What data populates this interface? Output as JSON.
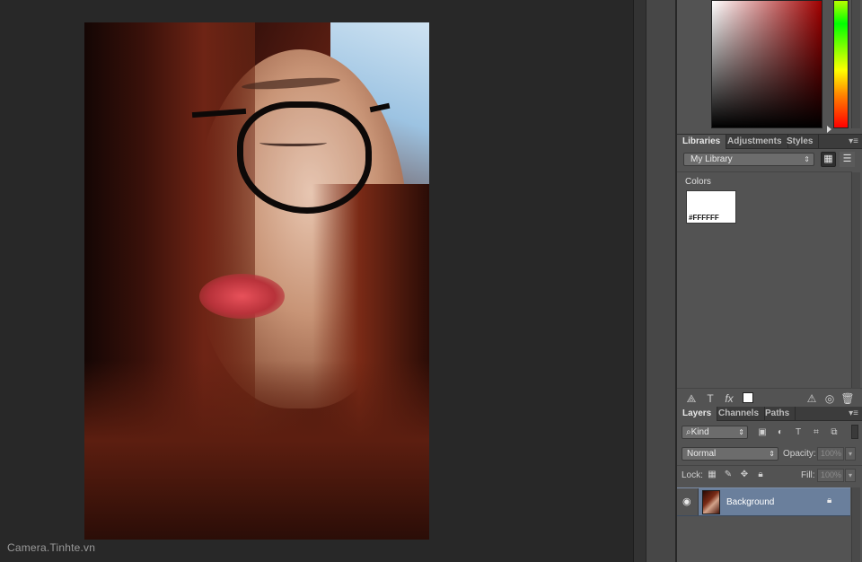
{
  "watermark": "Camera.Tinhte.vn",
  "colors": {
    "foreground": "#a00000",
    "panel_bg": "#535353",
    "canvas_bg": "#282828",
    "selected_layer": "#6a7f9c"
  },
  "libraries_panel": {
    "tabs": [
      {
        "label": "Libraries",
        "active": true
      },
      {
        "label": "Adjustments",
        "active": false
      },
      {
        "label": "Styles",
        "active": false
      }
    ],
    "menu_icon": "panel-menu-icon",
    "library_select": "My Library",
    "section_label": "Colors",
    "swatches": [
      {
        "label": "#FFFFFF",
        "color": "#FFFFFF"
      }
    ],
    "footer_icons": [
      "add-graphic-icon",
      "text-icon",
      "fx-icon",
      "color-swatch-icon",
      "warning-icon",
      "sync-icon",
      "trash-icon"
    ]
  },
  "layers_panel": {
    "tabs": [
      {
        "label": "Layers",
        "active": true
      },
      {
        "label": "Channels",
        "active": false
      },
      {
        "label": "Paths",
        "active": false
      }
    ],
    "filter_kind": "Kind",
    "blend_mode": "Normal",
    "opacity_label": "Opacity:",
    "opacity_value": "100%",
    "lock_label": "Lock:",
    "fill_label": "Fill:",
    "fill_value": "100%",
    "layers": [
      {
        "name": "Background",
        "visible": true,
        "locked": true
      }
    ]
  }
}
